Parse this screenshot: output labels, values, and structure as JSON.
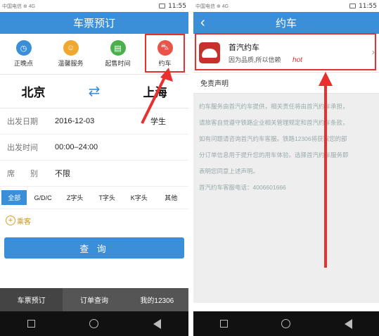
{
  "left": {
    "status_left": "中国电信 ⊕ 4G",
    "status_sub": "未登卡",
    "time": "11:55",
    "title": "车票预订",
    "icons": [
      {
        "label": "正晚点",
        "icon": "clock-icon",
        "color": "#3a8fd8"
      },
      {
        "label": "温馨服务",
        "icon": "service-icon",
        "color": "#f0a830"
      },
      {
        "label": "起售时间",
        "icon": "ticket-icon",
        "color": "#4bb04b"
      },
      {
        "label": "约车",
        "icon": "car-icon",
        "color": "#e8534a"
      }
    ],
    "from_city": "北京",
    "to_city": "上海",
    "swap_icon": "swap-icon",
    "date_label": "出发日期",
    "date_value": "2016-12-03",
    "student_label": "学生",
    "time_label": "出发时间",
    "time_value": "00:00–24:00",
    "seat_label": "席　　别",
    "seat_value": "不限",
    "train_tabs": [
      "全部",
      "G/D/C",
      "Z字头",
      "T字头",
      "K字头",
      "其他"
    ],
    "add_passenger": "乘客",
    "query_button": "查 询",
    "bottom_tabs": [
      "车票预订",
      "订单查询",
      "我的12306"
    ]
  },
  "right": {
    "status_left": "中国电信 ⊕ 4G",
    "status_sub": "未登卡",
    "time": "11:55",
    "title": "约车",
    "back_icon": "back-arrow-icon",
    "service_name": "首汽约车",
    "service_tagline": "因为品质,所以信赖",
    "hot_label": "hot",
    "disclaimer_title": "免责声明",
    "disclaimer_lines": [
      "约车服务由首汽约车提供，相关责任将由首汽约车承担，",
      "请旅客自觉遵守铁路企业相关管理规定和首汽约车条款，",
      "如有问题请咨询首汽约车客服。铁路12306将获取您的部",
      "分订单信息用于提升您的用车体验。选择首汽约车服务即",
      "表明您同意上述声明。",
      "首汽约车客服电话：4006601666"
    ]
  },
  "colors": {
    "primary": "#3a8fd8",
    "highlight_red": "#e8302e"
  }
}
